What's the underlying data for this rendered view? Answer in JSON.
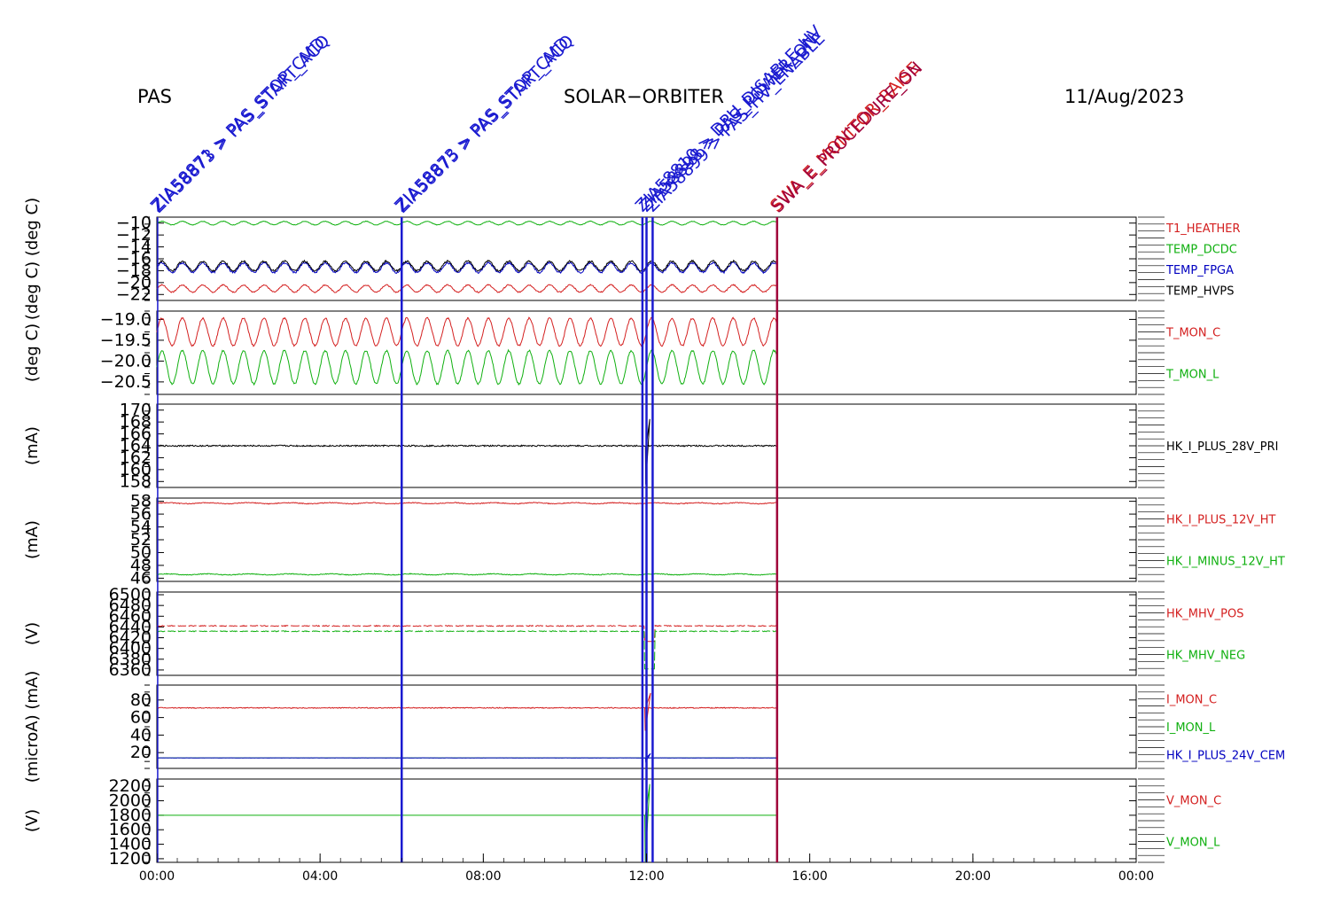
{
  "header": {
    "left": "PAS",
    "center": "SOLAR−ORBITER",
    "right": "11/Aug/2023"
  },
  "colors": {
    "red": "#d42020",
    "green": "#10b010",
    "blue": "#0000c0",
    "black": "#000000",
    "event_blue": "#1a1ad0",
    "event_red": "#d42020",
    "event_maroon": "#a0003a"
  },
  "chart_data": {
    "type": "line",
    "x_axis": {
      "range_hours": [
        0,
        24
      ],
      "ticks": [
        {
          "hour": 0,
          "label": "00:00"
        },
        {
          "hour": 4,
          "label": "04:00"
        },
        {
          "hour": 8,
          "label": "08:00"
        },
        {
          "hour": 12,
          "label": "12:00"
        },
        {
          "hour": 16,
          "label": "16:00"
        },
        {
          "hour": 20,
          "label": "20:00"
        },
        {
          "hour": 24,
          "label": "00:00"
        }
      ]
    },
    "events": [
      {
        "hour": 0.02,
        "color": "event_blue",
        "labels": [
          "ZIA58871 > PAS_STOP_CMD",
          "ZIA58873 > PAS_START_ACQ"
        ]
      },
      {
        "hour": 6.0,
        "color": "event_blue",
        "labels": [
          "ZIA58873 > PAS_STOP_CMD",
          "ZIA58875 > PAS_START_ACQ"
        ]
      },
      {
        "hour": 11.9,
        "color": "event_blue",
        "labels": [
          "ZIA58810 > DPU_DISABLE_HV"
        ]
      },
      {
        "hour": 12.0,
        "color": "event_blue",
        "labels": [
          "ZIA58898 > PAS_POWER_ON"
        ]
      },
      {
        "hour": 12.15,
        "color": "event_blue",
        "labels": [
          "ZIA58899 > PAS_HV_ENABLE"
        ]
      },
      {
        "hour": 15.2,
        "color": "event_maroon",
        "labels": [
          "SWA_E_MONITOR_RAISE",
          "SWA_E_PROCEDURE_ON"
        ]
      }
    ],
    "panels": [
      {
        "id": "temps",
        "ylabel": "(deg C)  (deg C)",
        "ylim": [
          -23,
          -9
        ],
        "yticks": [
          -10,
          -12,
          -14,
          -16,
          -18,
          -20,
          -22
        ],
        "ytick_labels": [
          "−10",
          "−12",
          "−14",
          "−16",
          "−18",
          "−20",
          "−22"
        ],
        "series": [
          {
            "name": "T1_HEATHER",
            "color": "red",
            "base": -21.0,
            "amp": 0.6,
            "period": 0.5,
            "noise": 0.1
          },
          {
            "name": "TEMP_DCDC",
            "color": "green",
            "base": -10.0,
            "amp": 0.3,
            "period": 0.5,
            "noise": 0.05
          },
          {
            "name": "TEMP_FPGA",
            "color": "blue",
            "base": -17.5,
            "amp": 0.8,
            "period": 0.5,
            "noise": 0.15
          },
          {
            "name": "TEMP_HVPS",
            "color": "black",
            "base": -17.2,
            "amp": 0.8,
            "period": 0.5,
            "noise": 0.15
          }
        ]
      },
      {
        "id": "tmon",
        "ylabel": "(deg C)",
        "ylim": [
          -20.8,
          -18.8
        ],
        "yticks": [
          -19.0,
          -19.5,
          -20.0,
          -20.5
        ],
        "ytick_labels": [
          "−19.0",
          "−19.5",
          "−20.0",
          "−20.5"
        ],
        "series": [
          {
            "name": "T_MON_C",
            "color": "red",
            "base": -19.3,
            "amp": 0.33,
            "period": 0.5,
            "noise": 0.02
          },
          {
            "name": "T_MON_L",
            "color": "green",
            "base": -20.15,
            "amp": 0.4,
            "period": 0.5,
            "noise": 0.02
          }
        ]
      },
      {
        "id": "i28",
        "ylabel": "(mA)",
        "ylim": [
          157,
          171
        ],
        "yticks": [
          158,
          160,
          162,
          164,
          166,
          168,
          170
        ],
        "ytick_labels": [
          "158",
          "160",
          "162",
          "164",
          "166",
          "168",
          "170"
        ],
        "series": [
          {
            "name": "HK_I_PLUS_28V_PRI",
            "color": "black",
            "base": 164.0,
            "amp": 0.0,
            "period": 1,
            "noise": 0.12,
            "glitch": [
              [
                11.98,
                157.5
              ],
              [
                12.08,
                168.5
              ]
            ]
          }
        ]
      },
      {
        "id": "i12",
        "ylabel": "(mA)",
        "ylim": [
          45.5,
          58.5
        ],
        "yticks": [
          46,
          48,
          50,
          52,
          54,
          56,
          58
        ],
        "ytick_labels": [
          "46",
          "48",
          "50",
          "52",
          "54",
          "56",
          "58"
        ],
        "series": [
          {
            "name": "HK_I_PLUS_12V_HT",
            "color": "red",
            "base": 57.7,
            "amp": 0.08,
            "period": 1,
            "noise": 0.06
          },
          {
            "name": "HK_I_MINUS_12V_HT",
            "color": "green",
            "base": 46.6,
            "amp": 0.08,
            "period": 1,
            "noise": 0.06
          }
        ]
      },
      {
        "id": "mhv",
        "ylabel": "(V)",
        "ylim": [
          6350,
          6505
        ],
        "yticks": [
          6360,
          6380,
          6400,
          6420,
          6440,
          6460,
          6480,
          6500
        ],
        "ytick_labels": [
          "6360",
          "6380",
          "6400",
          "6420",
          "6440",
          "6460",
          "6480",
          "6500"
        ],
        "series": [
          {
            "name": "HK_MHV_POS",
            "color": "red",
            "base": 6442,
            "amp": 0.0,
            "period": 1,
            "noise": 0.8,
            "dashed": true,
            "gap": [
              11.95,
              12.2
            ],
            "gap_value": 6413
          },
          {
            "name": "HK_MHV_NEG",
            "color": "green",
            "base": 6432,
            "amp": 0.0,
            "period": 1,
            "noise": 0.8,
            "dashed": true,
            "gap": [
              11.95,
              12.2
            ],
            "gap_value": 6362
          }
        ]
      },
      {
        "id": "imon",
        "ylabel": "(microA)  (mA)",
        "ylim": [
          2,
          97
        ],
        "yticks": [
          20,
          40,
          60,
          80
        ],
        "ytick_labels": [
          "20",
          "40",
          "60",
          "80"
        ],
        "series": [
          {
            "name": "I_MON_C",
            "color": "red",
            "base": 71,
            "amp": 0.0,
            "period": 1,
            "noise": 0.5,
            "glitch": [
              [
                11.97,
                45
              ],
              [
                12.1,
                88
              ]
            ]
          },
          {
            "name": "I_MON_L",
            "color": "green",
            "base": 14,
            "amp": 0.0,
            "period": 1,
            "noise": 0.0,
            "flat_only": true
          },
          {
            "name": "HK_I_PLUS_24V_CEM",
            "color": "blue",
            "base": 14,
            "amp": 0.0,
            "period": 1,
            "noise": 0.1,
            "glitch": [
              [
                11.98,
                10
              ],
              [
                12.1,
                19
              ]
            ]
          }
        ]
      },
      {
        "id": "vmon",
        "ylabel": "(V)",
        "ylim": [
          1150,
          2300
        ],
        "yticks": [
          1200,
          1400,
          1600,
          1800,
          2000,
          2200
        ],
        "ytick_labels": [
          "1200",
          "1400",
          "1600",
          "1800",
          "2000",
          "2200"
        ],
        "series": [
          {
            "name": "V_MON_C",
            "color": "red",
            "base": 1800,
            "amp": 0.0,
            "period": 1,
            "noise": 0.0,
            "hidden_under": true
          },
          {
            "name": "V_MON_L",
            "color": "green",
            "base": 1800,
            "amp": 0.0,
            "period": 1,
            "noise": 0.0,
            "glitch": [
              [
                11.97,
                1160
              ],
              [
                12.08,
                2230
              ]
            ]
          }
        ]
      }
    ]
  }
}
